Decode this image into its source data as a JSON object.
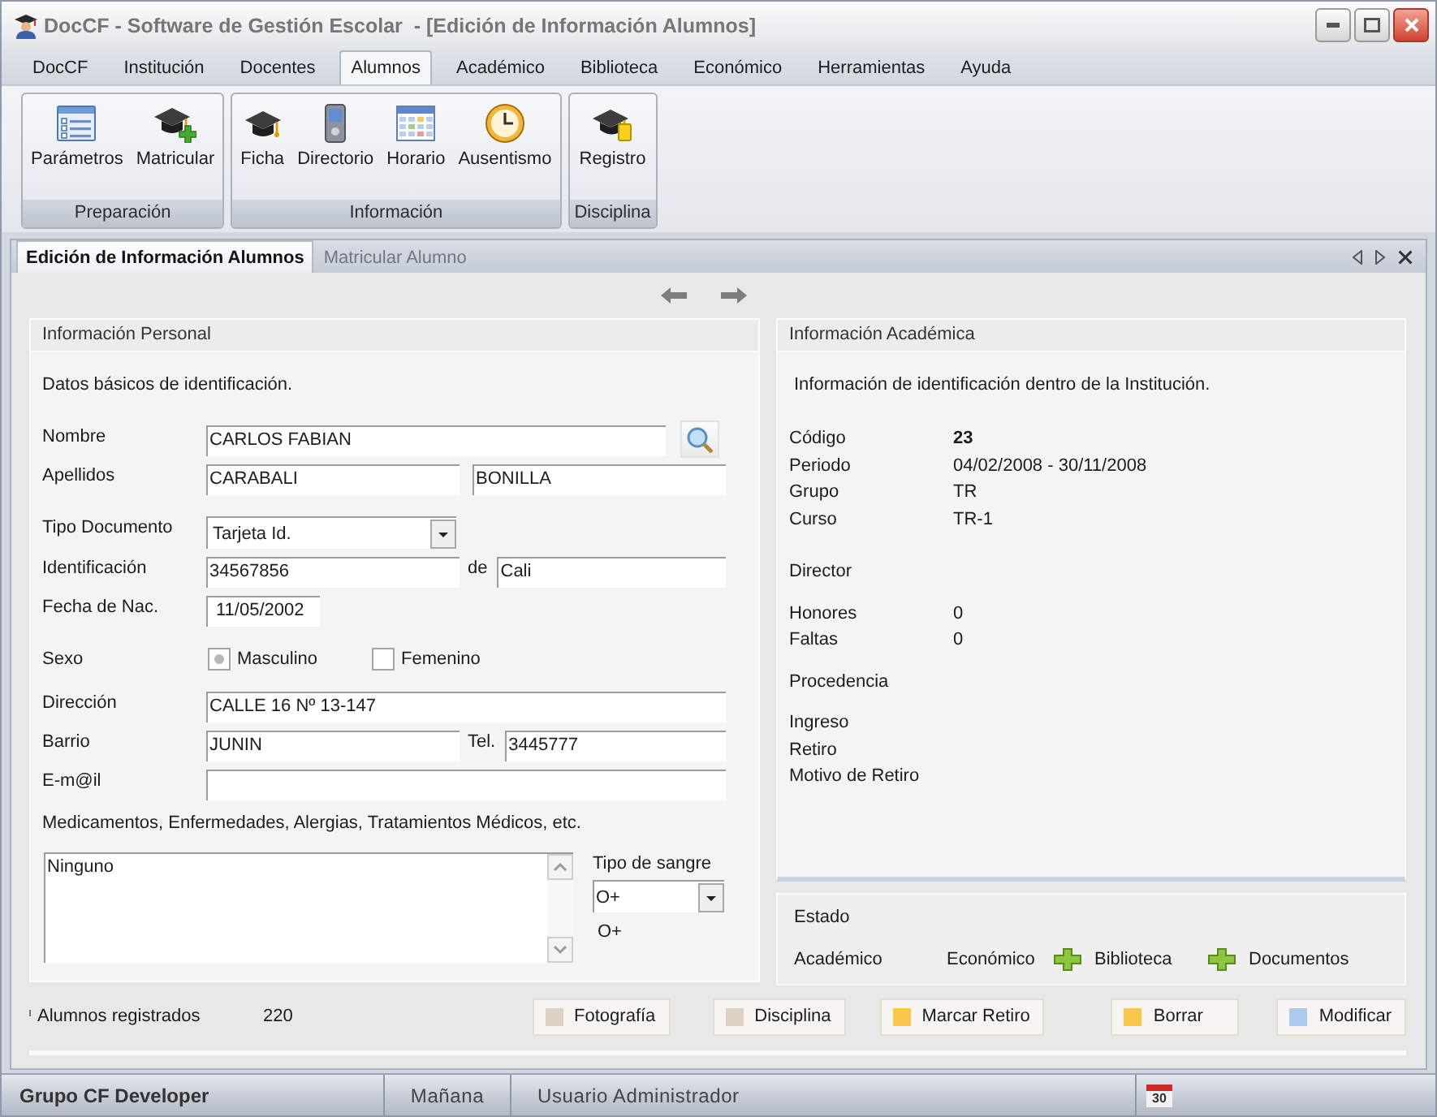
{
  "window": {
    "title": "DocCF - Software de Gestión Escolar  - [Edición de Información Alumnos]"
  },
  "menu_tabs": [
    {
      "label": "DocCF",
      "selected": false
    },
    {
      "label": "Institución",
      "selected": false
    },
    {
      "label": "Docentes",
      "selected": false
    },
    {
      "label": "Alumnos",
      "selected": true
    },
    {
      "label": "Académico",
      "selected": false
    },
    {
      "label": "Biblioteca",
      "selected": false
    },
    {
      "label": "Económico",
      "selected": false
    },
    {
      "label": "Herramientas",
      "selected": false
    },
    {
      "label": "Ayuda",
      "selected": false
    }
  ],
  "ribbon": {
    "groups": [
      {
        "title": "Preparación",
        "items": [
          {
            "label": "Parámetros"
          },
          {
            "label": "Matricular"
          }
        ]
      },
      {
        "title": "Información",
        "items": [
          {
            "label": "Ficha"
          },
          {
            "label": "Directorio"
          },
          {
            "label": "Horario"
          },
          {
            "label": "Ausentismo"
          }
        ]
      },
      {
        "title": "Disciplina",
        "items": [
          {
            "label": "Registro"
          }
        ]
      }
    ]
  },
  "document_tabs": [
    {
      "label": "Edición de Información Alumnos",
      "selected": true
    },
    {
      "label": "Matricular Alumno",
      "selected": false
    }
  ],
  "personal_info": {
    "title": "Información Personal",
    "intro": "Datos básicos de identificación.",
    "sections": [
      {
        "rows": [
          {
            "label": "Nombre",
            "controls": [
              {
                "kind": "text",
                "value": "CARLOS FABIAN"
              },
              {
                "kind": "search"
              }
            ]
          },
          {
            "label": "Apellidos",
            "controls": [
              {
                "kind": "text",
                "value": "CARABALI"
              },
              {
                "kind": "text",
                "value": "BONILLA"
              }
            ]
          }
        ]
      },
      {
        "rows": [
          {
            "label": "Tipo Documento",
            "controls": [
              {
                "kind": "select",
                "value": "Tarjeta Id."
              }
            ]
          },
          {
            "label": "Identificación",
            "controls": [
              {
                "kind": "text",
                "value": "34567856"
              },
              {
                "kind": "caption",
                "text": "de"
              },
              {
                "kind": "text",
                "value": "Cali"
              }
            ]
          },
          {
            "label": "Fecha de Nac.",
            "controls": [
              {
                "kind": "date",
                "value": "11/05/2002"
              }
            ]
          }
        ]
      },
      {
        "rows": [
          {
            "label": "Sexo",
            "controls": [
              {
                "kind": "option",
                "label": "Masculino",
                "selected": true
              },
              {
                "kind": "option",
                "label": "Femenino",
                "selected": false
              }
            ]
          }
        ]
      },
      {
        "rows": [
          {
            "label": "Dirección",
            "controls": [
              {
                "kind": "text",
                "value": "CALLE 16 Nº 13-147"
              }
            ]
          },
          {
            "label": "Barrio",
            "controls": [
              {
                "kind": "text",
                "value": "JUNIN"
              },
              {
                "kind": "caption",
                "text": "Tel."
              },
              {
                "kind": "text",
                "value": "3445777"
              }
            ]
          },
          {
            "label": "E-m@il",
            "controls": [
              {
                "kind": "text"
              }
            ]
          }
        ]
      }
    ],
    "medical": {
      "label": "Medicamentos, Enfermedades, Alergias, Tratamientos Médicos, etc.",
      "notes": "Ninguno",
      "blood_type_label": "Tipo de sangre",
      "blood_type": "O+",
      "blood_type_text": "O+"
    }
  },
  "academic_info": {
    "title": "Información Académica",
    "intro": "Información de identificación dentro de la Institución.",
    "groups": [
      {
        "rows": [
          {
            "label": "Código",
            "value": "23",
            "strong": true
          },
          {
            "label": "Periodo",
            "value": "04/02/2008 - 30/11/2008",
            "strong": false
          },
          {
            "label": "Grupo",
            "value": "TR",
            "strong": false
          },
          {
            "label": "Curso",
            "value": "TR-1",
            "strong": false
          }
        ]
      },
      {
        "rows": [
          {
            "label": "Director"
          }
        ]
      },
      {
        "rows": [
          {
            "label": "Honores",
            "value": "0",
            "strong": false
          },
          {
            "label": "Faltas",
            "value": "0",
            "strong": false
          }
        ]
      },
      {
        "rows": [
          {
            "label": "Procedencia"
          }
        ]
      },
      {
        "rows": [
          {
            "label": "Ingreso"
          },
          {
            "label": "Retiro"
          },
          {
            "label": "Motivo de Retiro"
          }
        ]
      }
    ]
  },
  "status_panel": {
    "title": "Estado",
    "items": [
      {
        "label": "Académico",
        "flagged": false
      },
      {
        "label": "Económico",
        "flagged": false
      },
      {
        "label": "Biblioteca",
        "flagged": true
      },
      {
        "label": "Documentos",
        "flagged": true
      }
    ]
  },
  "summary": {
    "label": "Alumnos registrados",
    "value": "220"
  },
  "actions": [
    {
      "label": "Fotografía",
      "color": "#ddd2c2"
    },
    {
      "label": "Disciplina",
      "color": "#ddd2c2"
    },
    {
      "label": "Marcar Retiro",
      "color": "#f9c84b"
    },
    {
      "label": "Borrar",
      "color": "#f9c84b"
    },
    {
      "label": "Modificar",
      "color": "#acc9ef"
    }
  ],
  "status_bar": {
    "cells": [
      {
        "text": "Grupo CF Developer",
        "strong": true
      },
      {
        "text": "Mañana",
        "strong": false
      },
      {
        "text": "Usuario Administrador",
        "strong": false
      }
    ],
    "calendar_day": "30"
  }
}
